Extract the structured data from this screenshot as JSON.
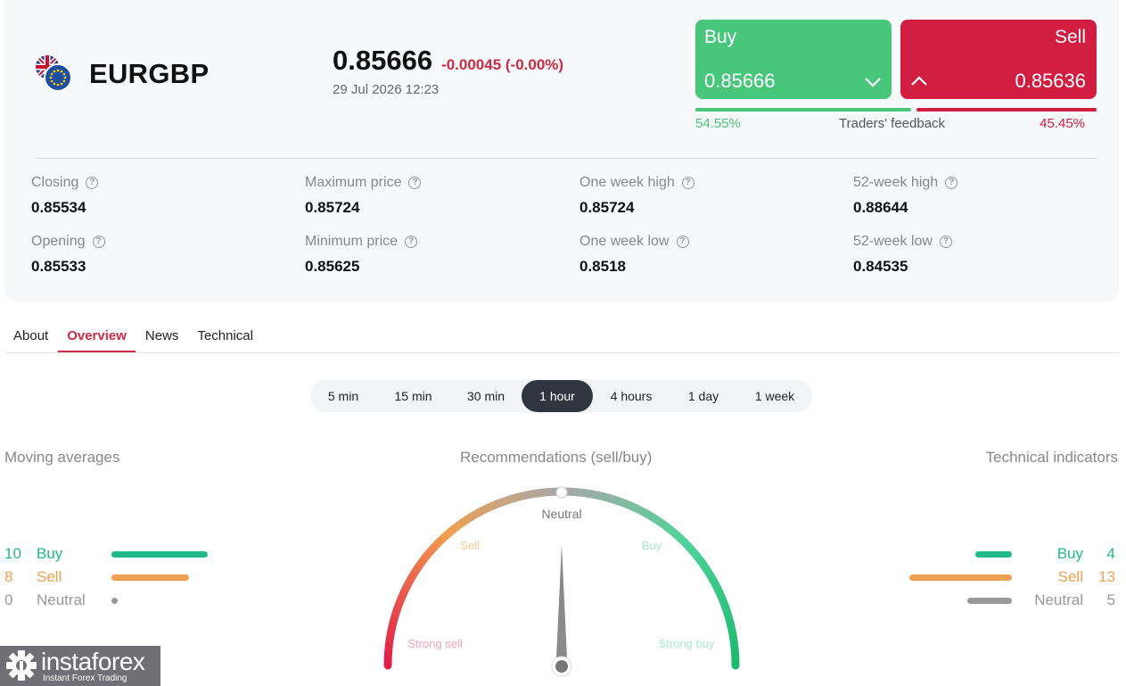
{
  "instrument": {
    "symbol": "EURGBP",
    "price": "0.85666",
    "change": "-0.00045 (-0.00%)",
    "datetime": "29 Jul 2026 12:23"
  },
  "trade": {
    "buy_label": "Buy",
    "buy_price": "0.85666",
    "sell_label": "Sell",
    "sell_price": "0.85636"
  },
  "feedback": {
    "label": "Traders' feedback",
    "buy_pct": "54.55%",
    "sell_pct": "45.45%",
    "buy_share": 0.5455,
    "buy_color": "#48c67c",
    "sell_color": "#d01d40"
  },
  "stats": {
    "closing_label": "Closing",
    "closing": "0.85534",
    "opening_label": "Opening",
    "opening": "0.85533",
    "max_label": "Maximum price",
    "max": "0.85724",
    "min_label": "Minimum price",
    "min": "0.85625",
    "week_high_label": "One week high",
    "week_high": "0.85724",
    "week_low_label": "One week low",
    "week_low": "0.8518",
    "year_high_label": "52-week high",
    "year_high": "0.88644",
    "year_low_label": "52-week low",
    "year_low": "0.84535",
    "help_glyph": "?"
  },
  "tabs": [
    "About",
    "Overview",
    "News",
    "Technical"
  ],
  "active_tab": "Overview",
  "timeframes": [
    "5 min",
    "15 min",
    "30 min",
    "1 hour",
    "4 hours",
    "1 day",
    "1 week"
  ],
  "active_timeframe": "1 hour",
  "sections": {
    "moving_averages": "Moving averages",
    "recommendations": "Recommendations (sell/buy)",
    "technical_indicators": "Technical indicators"
  },
  "moving_averages": {
    "buy": {
      "count": "10",
      "label": "Buy"
    },
    "sell": {
      "count": "8",
      "label": "Sell"
    },
    "neutral": {
      "count": "0",
      "label": "Neutral"
    }
  },
  "technical_indicators": {
    "buy": {
      "count": "4",
      "label": "Buy"
    },
    "sell": {
      "count": "13",
      "label": "Sell"
    },
    "neutral": {
      "count": "5",
      "label": "Neutral"
    }
  },
  "gauge": {
    "neutral": "Neutral",
    "sell": "Sell",
    "buy": "Buy",
    "strong_sell": "Strong sell",
    "strong_buy": "Strong buy",
    "needle_position": "Neutral"
  },
  "colors": {
    "buy": "#1fb889",
    "sell": "#f0a050",
    "neutral": "#999999",
    "accent": "#cc2a45"
  },
  "logo": {
    "name": "instaforex",
    "tagline": "Instant Forex Trading"
  }
}
